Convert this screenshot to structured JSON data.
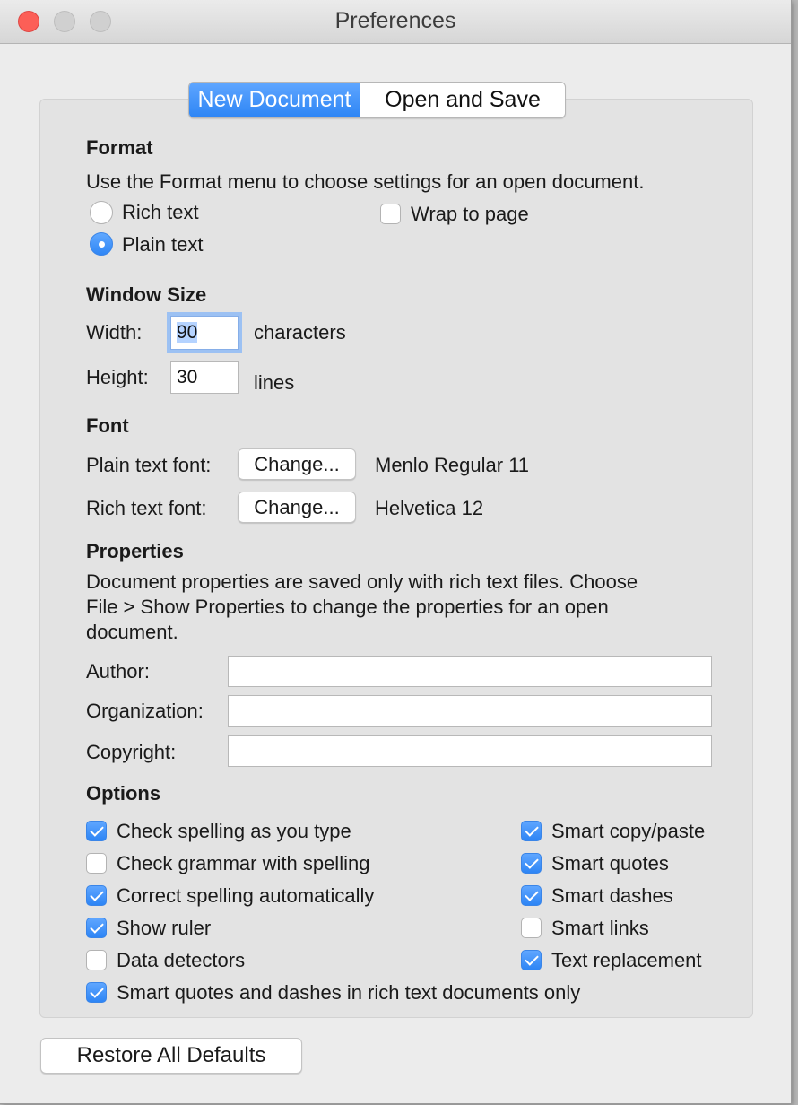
{
  "window": {
    "title": "Preferences"
  },
  "tabs": [
    {
      "label": "New Document",
      "selected": true
    },
    {
      "label": "Open and Save",
      "selected": false
    }
  ],
  "format": {
    "heading": "Format",
    "description": "Use the Format menu to choose settings for an open document.",
    "rich_text_label": "Rich text",
    "plain_text_label": "Plain text",
    "selected": "Plain text",
    "wrap_to_page_label": "Wrap to page",
    "wrap_to_page_checked": false
  },
  "window_size": {
    "heading": "Window Size",
    "width_label": "Width:",
    "width_value": "90",
    "width_unit": "characters",
    "height_label": "Height:",
    "height_value": "30",
    "height_unit": "lines"
  },
  "font": {
    "heading": "Font",
    "plain_label": "Plain text font:",
    "plain_button": "Change...",
    "plain_value": "Menlo Regular 11",
    "rich_label": "Rich text font:",
    "rich_button": "Change...",
    "rich_value": "Helvetica 12"
  },
  "properties": {
    "heading": "Properties",
    "description_line1": "Document properties are saved only with rich text files. Choose",
    "description_line2": "File > Show Properties to change the properties for an open",
    "description_line3": "document.",
    "author_label": "Author:",
    "author_value": "",
    "organization_label": "Organization:",
    "organization_value": "",
    "copyright_label": "Copyright:",
    "copyright_value": ""
  },
  "options": {
    "heading": "Options",
    "left": [
      {
        "label": "Check spelling as you type",
        "checked": true
      },
      {
        "label": "Check grammar with spelling",
        "checked": false
      },
      {
        "label": "Correct spelling automatically",
        "checked": true
      },
      {
        "label": "Show ruler",
        "checked": true
      },
      {
        "label": "Data detectors",
        "checked": false
      },
      {
        "label": "Smart quotes and dashes in rich text documents only",
        "checked": true
      }
    ],
    "right": [
      {
        "label": "Smart copy/paste",
        "checked": true
      },
      {
        "label": "Smart quotes",
        "checked": true
      },
      {
        "label": "Smart dashes",
        "checked": true
      },
      {
        "label": "Smart links",
        "checked": false
      },
      {
        "label": "Text replacement",
        "checked": true
      }
    ]
  },
  "restore_button": "Restore All Defaults",
  "colors": {
    "accent": "#2d85f5",
    "close": "#fc5f57",
    "panel": "#e3e3e3",
    "window": "#ececec"
  }
}
